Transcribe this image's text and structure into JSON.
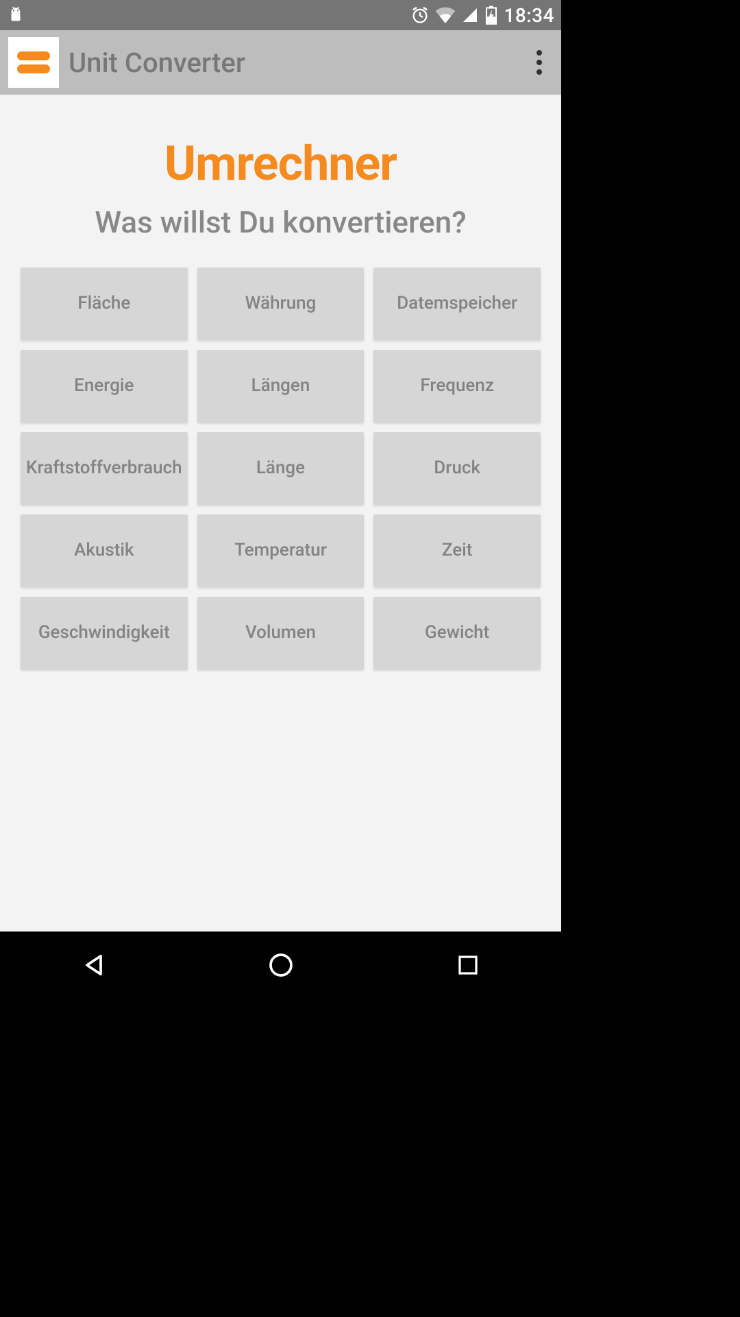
{
  "status": {
    "time": "18:34"
  },
  "appbar": {
    "title": "Unit Converter"
  },
  "main": {
    "heading": "Umrechner",
    "subheading": "Was willst Du konvertieren?",
    "tiles": [
      "Fläche",
      "Währung",
      "Datemspeicher",
      "Energie",
      "Längen",
      "Frequenz",
      "Kraftstoffverbrauch",
      "Länge",
      "Druck",
      "Akustik",
      "Temperatur",
      "Zeit",
      "Geschwindigkeit",
      "Volumen",
      "Gewicht"
    ]
  }
}
